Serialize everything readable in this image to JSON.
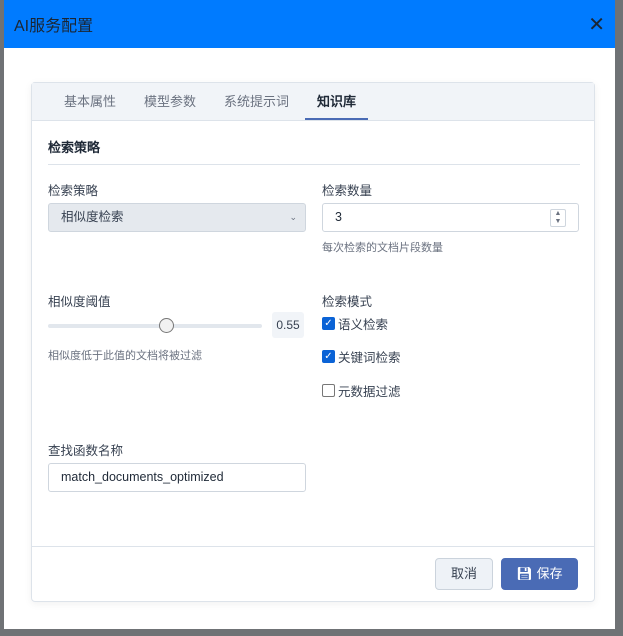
{
  "dialog": {
    "title": "AI服务配置",
    "close": "✕"
  },
  "tabs": [
    {
      "label": "基本属性"
    },
    {
      "label": "模型参数"
    },
    {
      "label": "系统提示词"
    },
    {
      "label": "知识库"
    }
  ],
  "section_title": "检索策略",
  "strategy": {
    "label": "检索策略",
    "value": "相似度检索"
  },
  "count": {
    "label": "检索数量",
    "value": "3",
    "hint": "每次检索的文档片段数量"
  },
  "threshold": {
    "label": "相似度阈值",
    "value": 0.55,
    "display": "0.55",
    "hint": "相似度低于此值的文档将被过滤"
  },
  "mode": {
    "label": "检索模式",
    "options": [
      {
        "label": "语义检索",
        "checked": true
      },
      {
        "label": "关键词检索",
        "checked": true
      },
      {
        "label": "元数据过滤",
        "checked": false
      }
    ]
  },
  "func": {
    "label": "查找函数名称",
    "value": "match_documents_optimized"
  },
  "footer": {
    "cancel": "取消",
    "save": "保存"
  }
}
